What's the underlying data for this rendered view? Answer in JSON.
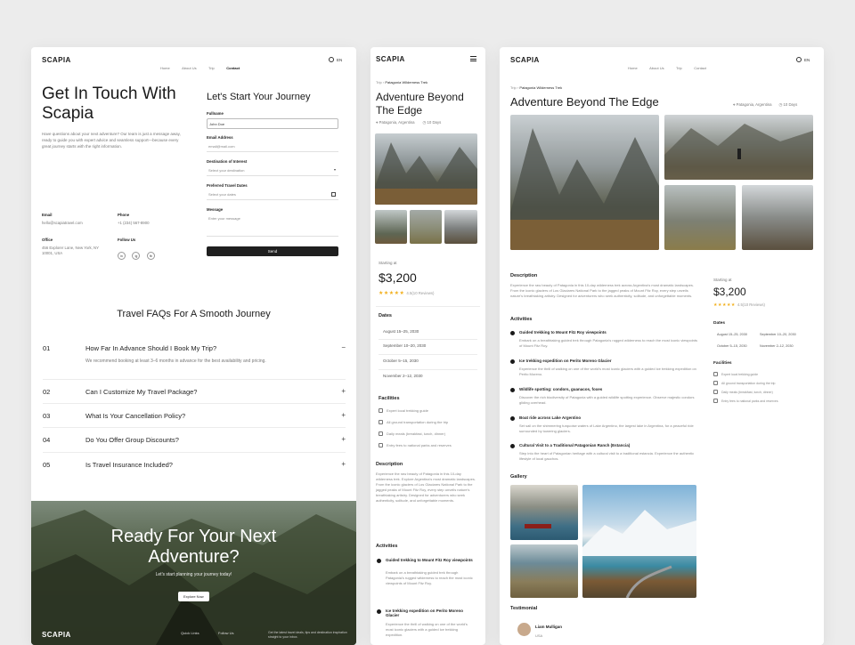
{
  "card1": {
    "logo": "SCAPIA",
    "nav": [
      {
        "label": "Home",
        "active": false
      },
      {
        "label": "About Us",
        "active": false
      },
      {
        "label": "Trip",
        "active": false
      },
      {
        "label": "Contact",
        "active": true
      }
    ],
    "lang": "EN",
    "heading_line1": "Get In Touch With",
    "heading_line2": "Scapia",
    "intro": "Have questions about your next adventure? Our team is just a message away, ready to guide you with expert advice and seamless support—because every great journey starts with the right information.",
    "email_label": "Email",
    "email_value": "hello@scapiatravel.com",
    "phone_label": "Phone",
    "phone_value": "+1 (234) 567-8900",
    "office_label": "Office",
    "office_value": "456 Explorer Lane, New York, NY 10001, USA",
    "follow_label": "Follow Us",
    "socials": [
      "in",
      "ig",
      "fb"
    ],
    "form_title": "Let's Start Your Journey",
    "form": {
      "fullname_label": "Fullname",
      "fullname_value": "John Doe",
      "email_label": "Email Address",
      "email_placeholder": "email@mail.com",
      "destination_label": "Destination of Interest",
      "destination_placeholder": "Select your destination",
      "dates_label": "Preferred Travel Dates",
      "dates_placeholder": "Select your dates",
      "message_label": "Message",
      "message_placeholder": "Enter your message",
      "send_label": "Send"
    },
    "faq_title": "Travel FAQs For A Smooth Journey",
    "faqs": [
      {
        "num": "01",
        "q": "How Far In Advance Should I Book My Trip?",
        "a": "We recommend booking at least 3–6 months in advance for the best availability and pricing.",
        "sign": "−"
      },
      {
        "num": "02",
        "q": "Can I Customize My Travel Package?",
        "sign": "+"
      },
      {
        "num": "03",
        "q": "What Is Your Cancellation Policy?",
        "sign": "+"
      },
      {
        "num": "04",
        "q": "Do You Offer Group Discounts?",
        "sign": "+"
      },
      {
        "num": "05",
        "q": "Is Travel Insurance Included?",
        "sign": "+"
      }
    ],
    "hero_line1": "Ready For Your Next",
    "hero_line2": "Adventure?",
    "hero_sub": "Let's start planning your journey today!",
    "hero_button": "Explore Now",
    "footer_logo": "SCAPIA",
    "footer_quick": "Quick Links",
    "footer_follow": "Follow Us",
    "footer_news": "Get the latest travel deals, tips and destination inspiration straight to your inbox."
  },
  "card2": {
    "logo": "SCAPIA",
    "crumb_root": "Trip",
    "crumb_current": "Patagonia Wilderness Trek",
    "title_line1": "Adventure Beyond",
    "title_line2": "The Edge",
    "location": "Patagonia, Argentina",
    "duration": "10 Days",
    "starting_label": "Starting at",
    "price": "$3,200",
    "rating": "4.5(10 Reviews)",
    "dates_title": "Dates",
    "dates": [
      "August 15–25, 2030",
      "September 10–20, 2030",
      "October 5–15, 2030",
      "November 2–12, 2030"
    ],
    "facilities_title": "Facilities",
    "facilities": [
      "Expert local trekking guide",
      "All ground transportation during the trip",
      "Daily meals (breakfast, lunch, dinner)",
      "Entry fees to national parks and reserves"
    ],
    "description_title": "Description",
    "description": "Experience the raw beauty of Patagonia in this 10-day wilderness trek. Explore Argentina's most dramatic landscapes. From the iconic glaciers of Los Glaciares National Park to the jagged peaks of Mount Fitz Roy, every step unveils nature's breathtaking artistry. Designed for adventurers who seek authenticity, solitude, and unforgettable moments.",
    "activities_title": "Activities",
    "activities": [
      {
        "t": "Guided trekking to Mount Fitz Roy viewpoints",
        "d": "Embark on a breathtaking guided trek through Patagonia's rugged wilderness to reach the most iconic viewpoints of Mount Fitz Roy."
      },
      {
        "t": "Ice trekking expedition on Perito Moreno Glacier",
        "d": "Experience the thrill of walking on one of the world's most iconic glaciers with a guided ice trekking expedition."
      }
    ]
  },
  "card3": {
    "logo": "SCAPIA",
    "nav": [
      {
        "label": "Home"
      },
      {
        "label": "About Us"
      },
      {
        "label": "Trip"
      },
      {
        "label": "Contact"
      }
    ],
    "lang": "EN",
    "crumb_root": "Trip",
    "crumb_current": "Patagonia Wilderness Trek",
    "title": "Adventure Beyond The Edge",
    "location": "Patagonia, Argentina",
    "duration": "10 Days",
    "description_title": "Description",
    "description": "Experience the raw beauty of Patagonia in this 10-day wilderness trek across Argentina's most dramatic landscapes. From the iconic glaciers of Los Glaciares National Park to the jagged peaks of Mount Fitz Roy, every step unveils nature's breathtaking artistry. Designed for adventurers who seek authenticity, solitude, and unforgettable moments.",
    "starting_label": "Starting at",
    "price": "$3,200",
    "rating": "4.5(10 Reviews)",
    "dates_title": "Dates",
    "dates": [
      "August 15–25, 2030",
      "September 10–20, 2030",
      "October 5–15, 2030",
      "November 2–12, 2030"
    ],
    "facilities_title": "Facilities",
    "facilities": [
      "Expert local trekking guide",
      "All ground transportation during the trip",
      "Daily meals (breakfast, lunch, dinner)",
      "Entry fees to national parks and reserves"
    ],
    "activities_title": "Activities",
    "activities": [
      {
        "t": "Guided trekking to Mount Fitz Roy viewpoints",
        "d": "Embark on a breathtaking guided trek through Patagonia's rugged wilderness to reach the most iconic viewpoints of Mount Fitz Roy."
      },
      {
        "t": "Ice trekking expedition on Perito Moreno Glacier",
        "d": "Experience the thrill of walking on one of the world's most iconic glaciers with a guided ice trekking expedition on Perito Moreno."
      },
      {
        "t": "Wildlife spotting: condors, guanacos, foxes",
        "d": "Discover the rich biodiversity of Patagonia with a guided wildlife spotting experience. Observe majestic condors gliding overhead."
      },
      {
        "t": "Boat ride across Lake Argentino",
        "d": "Set sail on the shimmering turquoise waters of Lake Argentino, the largest lake in Argentina, for a peaceful ride surrounded by towering glaciers."
      },
      {
        "t": "Cultural Visit to a Traditional Patagonian Ranch (Estancia)",
        "d": "Step into the heart of Patagonian heritage with a cultural visit to a traditional estancia. Experience the authentic lifestyle of local gauchos."
      }
    ],
    "gallery_title": "Gallery",
    "testimonial_title": "Testimonial",
    "testimonial_name": "Liam Mulligan",
    "testimonial_country": "USA"
  },
  "colors": {
    "accent_dark": "#1f1f1f",
    "star": "#f2b01e",
    "background": "#ececec"
  }
}
